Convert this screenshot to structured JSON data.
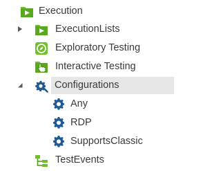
{
  "colors": {
    "accent_green": "#6fbf28",
    "accent_green_dark": "#4f9a17",
    "gear_blue": "#1f5a96",
    "selection_bg": "#e6e6e6",
    "expander_gray": "#5a5a5a"
  },
  "tree": {
    "execution": {
      "label": "Execution",
      "icon": "play-folder-icon",
      "state": "expanded"
    },
    "execution_lists": {
      "label": "ExecutionLists",
      "icon": "play-folder-icon",
      "state": "collapsed"
    },
    "exploratory_testing": {
      "label": "Exploratory Testing",
      "icon": "compass-icon"
    },
    "interactive_testing": {
      "label": "Interactive Testing",
      "icon": "hand-cursor-icon"
    },
    "configurations": {
      "label": "Configurations",
      "icon": "gear-wrench-icon",
      "state": "expanded",
      "selected": true
    },
    "config_any": {
      "label": "Any",
      "icon": "gear-icon"
    },
    "config_rdp": {
      "label": "RDP",
      "icon": "gear-icon"
    },
    "config_supports_classic": {
      "label": "SupportsClassic",
      "icon": "gear-icon"
    },
    "test_events": {
      "label": "TestEvents",
      "icon": "events-tree-icon"
    }
  }
}
